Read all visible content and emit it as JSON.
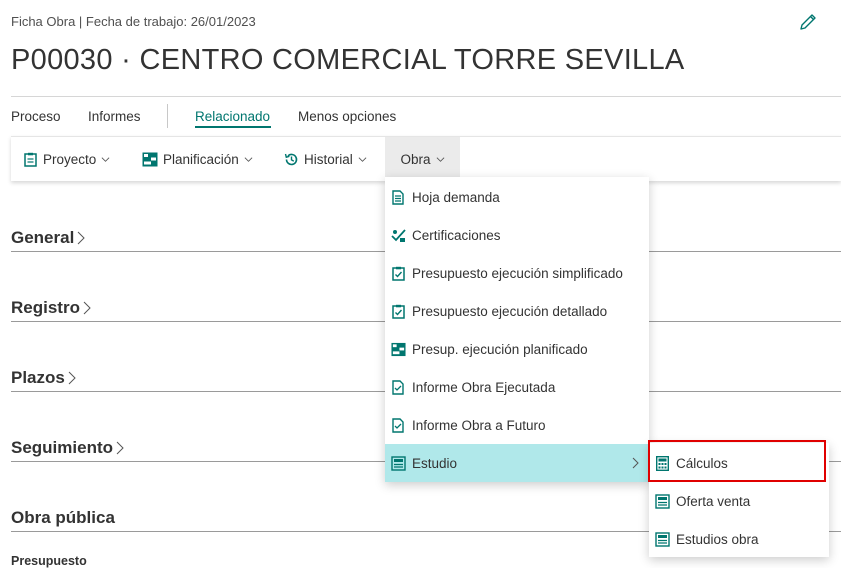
{
  "header": {
    "breadcrumb": "Ficha Obra | Fecha de trabajo: 26/01/2023",
    "title": "P00030 · CENTRO COMERCIAL TORRE SEVILLA"
  },
  "nav": {
    "tabs": [
      {
        "label": "Proceso"
      },
      {
        "label": "Informes"
      },
      {
        "label": "Relacionado",
        "active": true
      },
      {
        "label": "Menos opciones"
      }
    ]
  },
  "actionbar": {
    "items": [
      {
        "label": "Proyecto",
        "icon": "clipboard-icon"
      },
      {
        "label": "Planificación",
        "icon": "gantt-icon"
      },
      {
        "label": "Historial",
        "icon": "history-icon"
      },
      {
        "label": "Obra",
        "icon": "",
        "open": true
      }
    ]
  },
  "sections": [
    {
      "label": "General"
    },
    {
      "label": "Registro"
    },
    {
      "label": "Plazos"
    },
    {
      "label": "Seguimiento"
    },
    {
      "label": "Obra pública"
    }
  ],
  "field_label": "Presupuesto",
  "obra_menu": {
    "items": [
      {
        "label": "Hoja demanda",
        "icon": "document-icon"
      },
      {
        "label": "Certificaciones",
        "icon": "certificate-icon"
      },
      {
        "label": "Presupuesto ejecución simplificado",
        "icon": "clipboard-check-icon"
      },
      {
        "label": "Presupuesto ejecución detallado",
        "icon": "clipboard-check-icon"
      },
      {
        "label": "Presup. ejecución planificado",
        "icon": "gantt-icon"
      },
      {
        "label": "Informe Obra Ejecutada",
        "icon": "report-icon"
      },
      {
        "label": "Informe Obra a Futuro",
        "icon": "report-icon"
      },
      {
        "label": "Estudio",
        "icon": "study-icon",
        "highlighted": true,
        "has_submenu": true
      }
    ]
  },
  "estudio_submenu": {
    "items": [
      {
        "label": "Cálculos",
        "icon": "calculator-icon",
        "highlighted_box": true
      },
      {
        "label": "Oferta venta",
        "icon": "study-icon"
      },
      {
        "label": "Estudios obra",
        "icon": "study-icon"
      }
    ]
  },
  "colors": {
    "accent": "#00766f",
    "menu_highlight": "#b0e8ea",
    "annotation_box": "#e00000"
  }
}
